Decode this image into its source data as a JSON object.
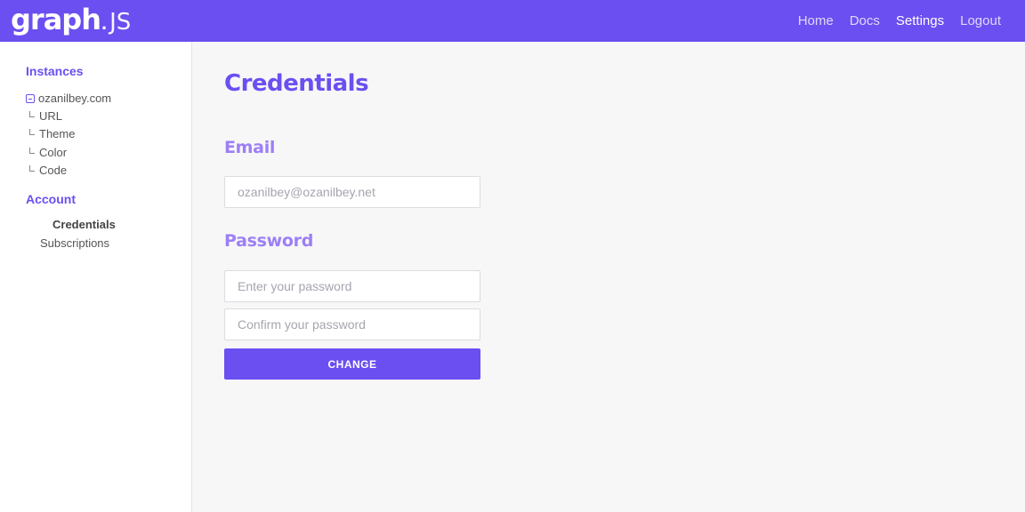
{
  "header": {
    "logo": {
      "bold": "graph",
      "dot": ".",
      "light": "JS"
    },
    "nav": [
      {
        "label": "Home"
      },
      {
        "label": "Docs"
      },
      {
        "label": "Settings"
      },
      {
        "label": "Logout"
      }
    ],
    "active_nav": "Settings"
  },
  "sidebar": {
    "instances_heading": "Instances",
    "instance": {
      "name": "ozanilbey.com",
      "children": [
        "URL",
        "Theme",
        "Color",
        "Code"
      ]
    },
    "account_heading": "Account",
    "account_items": [
      "Credentials",
      "Subscriptions"
    ],
    "active_account_item": "Credentials"
  },
  "main": {
    "title": "Credentials",
    "email_heading": "Email",
    "email_placeholder": "ozanilbey@ozanilbey.net",
    "password_heading": "Password",
    "password_placeholder": "Enter your password",
    "confirm_placeholder": "Confirm your password",
    "change_button": "CHANGE"
  },
  "colors": {
    "brand": "#6b4ff0",
    "section_heading": "#9d7ff5",
    "background": "#f7f7f8"
  }
}
